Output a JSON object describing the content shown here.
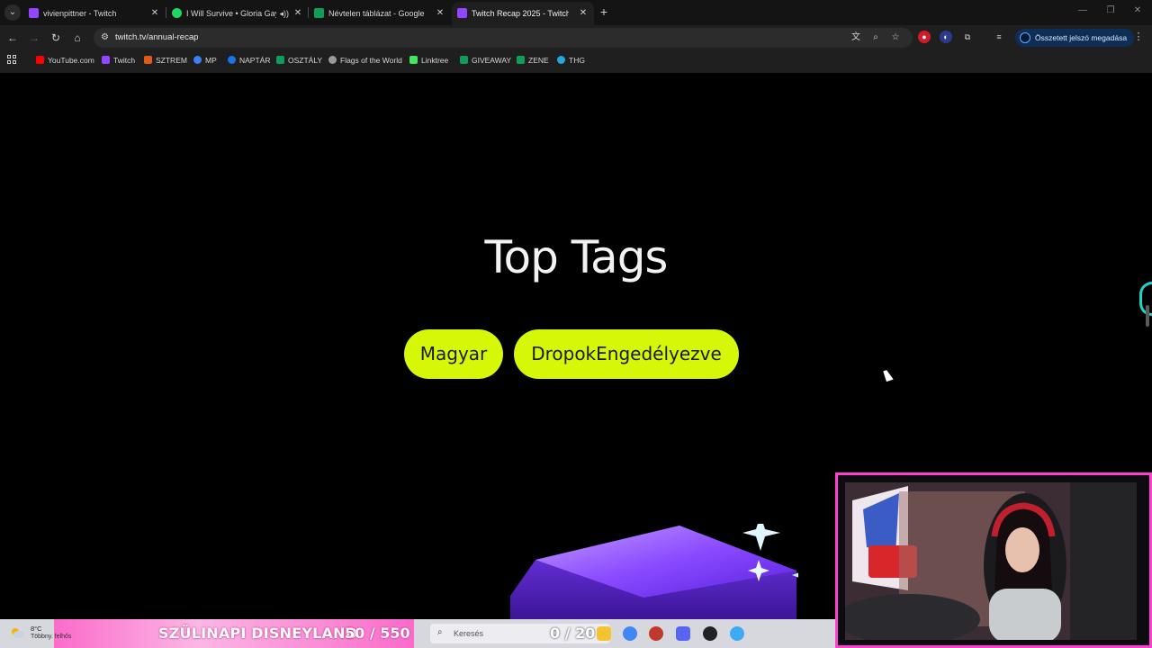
{
  "tabs": [
    {
      "title": "vivienpittner - Twitch",
      "icon": "twitch-icon",
      "color": "#9146ff"
    },
    {
      "title": "I Will Survive • Gloria Gaynor",
      "icon": "spotify-icon",
      "color": "#1ed760"
    },
    {
      "title": "Névtelen táblázat - Google Táblázatok",
      "icon": "sheets-icon",
      "color": "#0f9d58"
    },
    {
      "title": "Twitch Recap 2025 - Twitch",
      "icon": "twitch-icon",
      "color": "#9146ff"
    }
  ],
  "address_bar": {
    "url": "twitch.tv/annual-recap"
  },
  "password_button": {
    "label": "Összetett jelszó megadása"
  },
  "bookmarks": [
    {
      "label": "YouTube.com",
      "color": "#ff0000"
    },
    {
      "label": "Twitch",
      "color": "#9146ff"
    },
    {
      "label": "SZTREM",
      "color": "#e05a1a"
    },
    {
      "label": "MP",
      "color": "#3b82f6"
    },
    {
      "label": "NAPTÁR",
      "color": "#1a73e8"
    },
    {
      "label": "OSZTÁLY",
      "color": "#0f9d58"
    },
    {
      "label": "Flags of the World",
      "color": "#9a9a9a"
    },
    {
      "label": "Linktree",
      "color": "#43e55e"
    },
    {
      "label": "GIVEAWAY",
      "color": "#0f9d58"
    },
    {
      "label": "ZENE",
      "color": "#0f9d58"
    },
    {
      "label": "THG",
      "color": "#22a7e0"
    }
  ],
  "main": {
    "heading": "Top Tags",
    "tags": [
      "Magyar",
      "DropokEngedélyezve"
    ],
    "tag_color": "#d6f707"
  },
  "overlay": {
    "weather_temp": "8°C",
    "weather_cond": "Többny. felhős",
    "goal1_title": "SZÜLINAPI DISNEYLAND",
    "goal1_value": "50 / 550",
    "search_placeholder": "Keresés",
    "goal2_value": "0 / 20",
    "accent": "#ff3fd0"
  }
}
